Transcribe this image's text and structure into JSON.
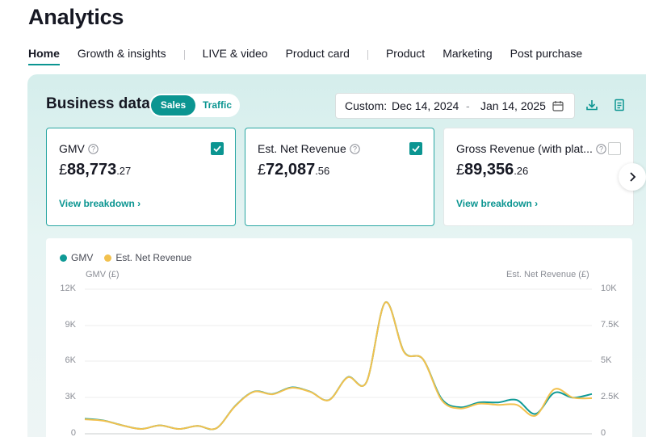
{
  "page_title": "Analytics",
  "nav": {
    "items": [
      {
        "label": "Home",
        "active": true
      },
      {
        "label": "Growth & insights",
        "active": false
      },
      {
        "label": "LIVE & video",
        "active": false
      },
      {
        "label": "Product card",
        "active": false
      },
      {
        "label": "Product",
        "active": false
      },
      {
        "label": "Marketing",
        "active": false
      },
      {
        "label": "Post purchase",
        "active": false
      }
    ]
  },
  "business": {
    "title": "Business data",
    "toggle": {
      "sales": "Sales",
      "traffic": "Traffic",
      "selected": "Sales"
    },
    "date_range": {
      "prefix": "Custom:",
      "start": "Dec 14, 2024",
      "separator": "-",
      "end": "Jan 14, 2025"
    },
    "icons": {
      "calendar": "calendar-icon",
      "download": "download-icon",
      "report": "report-icon"
    }
  },
  "cards": [
    {
      "label": "GMV",
      "checked": true,
      "currency": "£",
      "int": "88,773",
      "dec": ".27",
      "link": "View breakdown"
    },
    {
      "label": "Est. Net Revenue",
      "checked": true,
      "currency": "£",
      "int": "72,087",
      "dec": ".56",
      "link": ""
    },
    {
      "label": "Gross Revenue (with plat...",
      "checked": false,
      "currency": "£",
      "int": "89,356",
      "dec": ".26",
      "link": "View breakdown"
    }
  ],
  "colors": {
    "accent": "#0b9591",
    "gmv": "#0f9a96",
    "net": "#f2c14e"
  },
  "chart_data": {
    "type": "line",
    "legend": [
      "GMV",
      "Est. Net Revenue"
    ],
    "y_left_title": "GMV (£)",
    "y_right_title": "Est. Net Revenue (£)",
    "y_left_ticks": [
      "0",
      "3K",
      "6K",
      "9K",
      "12K"
    ],
    "y_right_ticks": [
      "0",
      "2.5K",
      "5K",
      "7.5K",
      "10K"
    ],
    "y_left_range": [
      0,
      12000
    ],
    "y_right_range": [
      0,
      10000
    ],
    "grid": true,
    "legend_position": "top-left",
    "series": [
      {
        "name": "GMV",
        "axis": "left",
        "values": [
          1250,
          1100,
          700,
          400,
          700,
          400,
          650,
          450,
          2300,
          3500,
          3300,
          3850,
          3500,
          2800,
          4700,
          4300,
          10900,
          6800,
          6200,
          2900,
          2200,
          2600,
          2600,
          2800,
          1650,
          3400,
          3000,
          3300
        ]
      },
      {
        "name": "Est. Net Revenue",
        "axis": "right",
        "values": [
          1000,
          900,
          580,
          330,
          580,
          330,
          540,
          380,
          1900,
          2900,
          2730,
          3180,
          2900,
          2330,
          3900,
          3580,
          9080,
          5650,
          5170,
          2330,
          1750,
          2080,
          2000,
          2000,
          1250,
          3080,
          2500,
          2460
        ]
      }
    ]
  }
}
